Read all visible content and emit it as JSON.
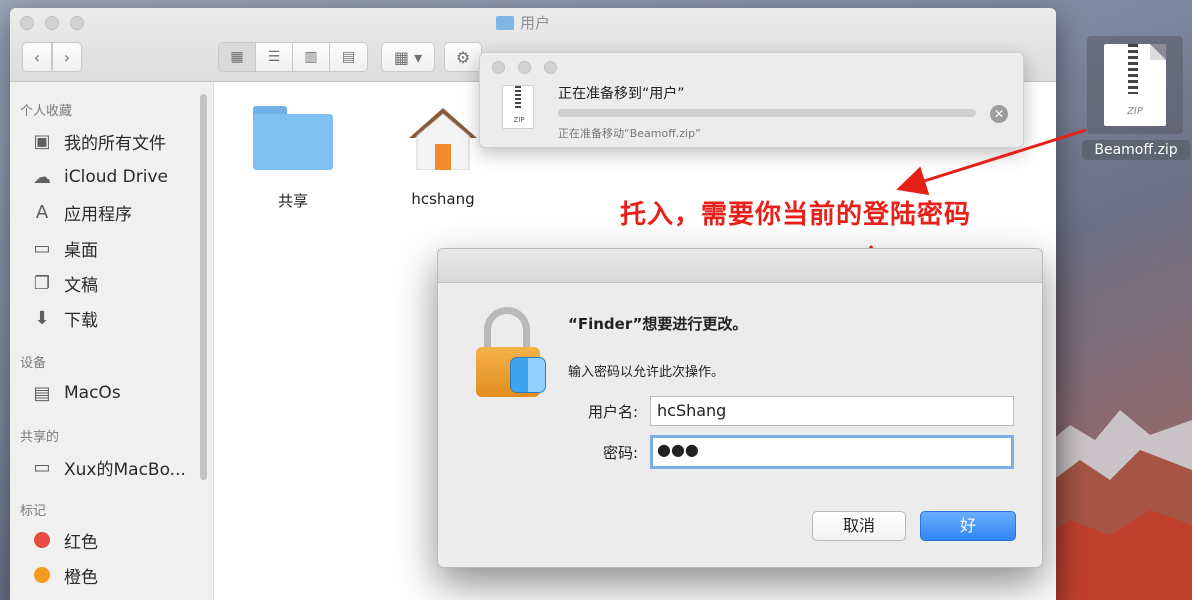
{
  "finder": {
    "window_title": "用户",
    "sidebar": {
      "favorites_title": "个人收藏",
      "favorites": [
        {
          "label": "我的所有文件",
          "icon": "all-files-icon"
        },
        {
          "label": "iCloud Drive",
          "icon": "cloud-icon"
        },
        {
          "label": "应用程序",
          "icon": "applications-icon"
        },
        {
          "label": "桌面",
          "icon": "desktop-icon"
        },
        {
          "label": "文稿",
          "icon": "documents-icon"
        },
        {
          "label": "下载",
          "icon": "download-icon"
        }
      ],
      "devices_title": "设备",
      "devices": [
        {
          "label": "MacOs",
          "icon": "disk-icon"
        }
      ],
      "shared_title": "共享的",
      "shared": [
        {
          "label": "Xux的MacBo...",
          "icon": "laptop-icon"
        }
      ],
      "tags_title": "标记",
      "tags": [
        {
          "label": "红色",
          "color": "#e84a3f"
        },
        {
          "label": "橙色",
          "color": "#f59b22"
        }
      ]
    },
    "content_items": [
      {
        "label": "共享",
        "icon": "folder-icon"
      },
      {
        "label": "hcshang",
        "icon": "home-icon"
      }
    ]
  },
  "copy_panel": {
    "title": "正在准备移到“用户”",
    "status": "正在准备移动“Beamoff.zip”",
    "progress": 0.0,
    "file_label": "ZIP"
  },
  "desktop_file": {
    "name": "Beamoff.zip",
    "type_label": "ZIP"
  },
  "annotation": {
    "text": "托入，需要你当前的登陆密码",
    "color": "#e8201a"
  },
  "auth_dialog": {
    "heading": "“Finder”想要进行更改。",
    "message": "输入密码以允许此次操作。",
    "username_label": "用户名:",
    "username_value": "hcShang",
    "password_label": "密码:",
    "password_value": "●●●",
    "cancel_label": "取消",
    "ok_label": "好"
  }
}
